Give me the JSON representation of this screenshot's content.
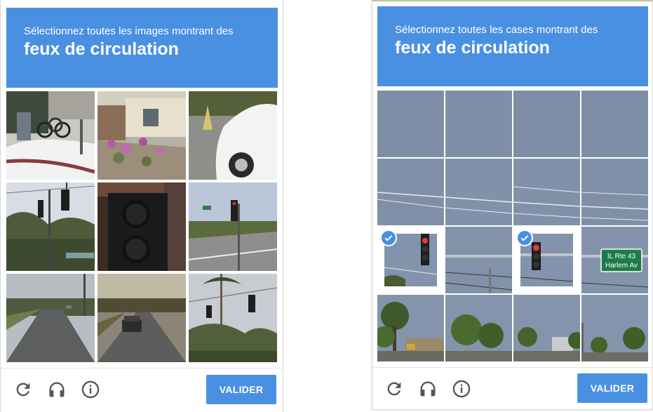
{
  "left_widget": {
    "instruction_line1": "Sélectionnez toutes les images montrant des",
    "instruction_line2": "feux de circulation",
    "tiles": [
      {
        "name": "snow-bicycles",
        "selected": false
      },
      {
        "name": "house-flowerbed",
        "selected": false
      },
      {
        "name": "white-car-traffic-cone",
        "selected": false
      },
      {
        "name": "traffic-lights-trees",
        "selected": false
      },
      {
        "name": "traffic-light-closeup",
        "selected": false
      },
      {
        "name": "intersection-traffic-light",
        "selected": false
      },
      {
        "name": "suburban-road",
        "selected": false
      },
      {
        "name": "road-with-car",
        "selected": false
      },
      {
        "name": "palm-trees-traffic-light",
        "selected": false
      }
    ],
    "verify_label": "VALIDER"
  },
  "right_widget": {
    "instruction_line1": "Sélectionnez toutes les cases montrant des",
    "instruction_line2": "feux de circulation",
    "sign_line1": "IL Rte 43",
    "sign_line2": "Harlem Av",
    "selected_tiles": [
      8,
      10
    ],
    "verify_label": "VALIDER"
  },
  "icons": [
    "reload-icon",
    "headphones-icon",
    "info-icon",
    "checkmark-icon"
  ],
  "colors": {
    "accent": "#4a90e2",
    "sky": "#7e8ea6"
  }
}
